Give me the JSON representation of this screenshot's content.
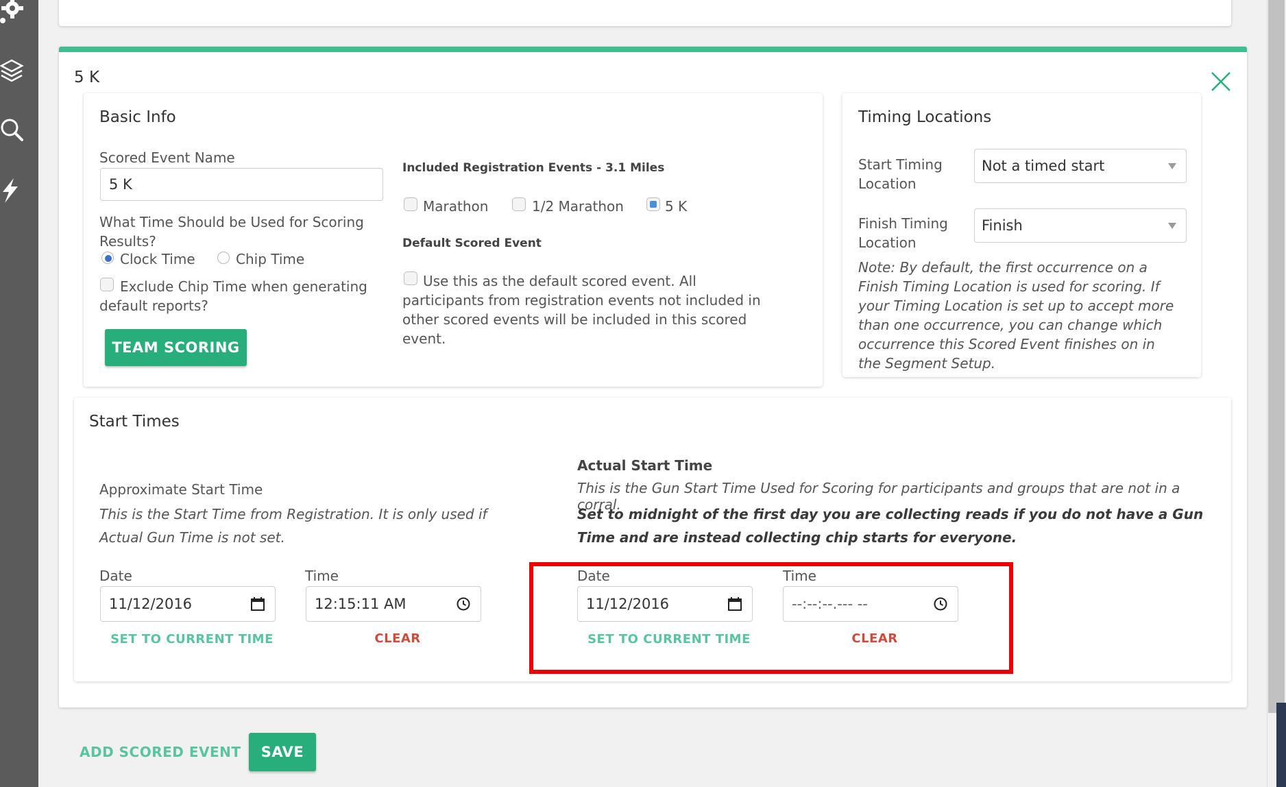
{
  "event": {
    "name": "5 K",
    "basic_info": {
      "heading": "Basic Info",
      "scored_event_name_label": "Scored Event Name",
      "scored_event_name_value": "5 K",
      "scoring_time_question": "What Time Should be Used for Scoring Results?",
      "clock_time_label": "Clock Time",
      "chip_time_label": "Chip Time",
      "selected_time": "Clock Time",
      "exclude_chip_label": "Exclude Chip Time when generating default reports?",
      "exclude_chip_checked": false,
      "team_scoring_button": "TEAM SCORING",
      "included_events_heading": "Included Registration Events - 3.1 Miles",
      "included_events": [
        {
          "label": "Marathon",
          "checked": false
        },
        {
          "label": "1/2 Marathon",
          "checked": false
        },
        {
          "label": "5 K",
          "checked": true
        }
      ],
      "default_scored_heading": "Default Scored Event",
      "default_scored_text": "Use this as the default scored event. All participants from registration events not included in other scored events will be included in this scored event.",
      "default_scored_checked": false
    },
    "timing_locations": {
      "heading": "Timing Locations",
      "start_label": "Start Timing Location",
      "start_value": "Not a timed start",
      "finish_label": "Finish Timing Location",
      "finish_value": "Finish",
      "note": "Note: By default, the first occurrence on a Finish Timing Location is used for scoring. If your Timing Location is set up to accept more than one occurrence, you can change which occurrence this Scored Event finishes on in the Segment Setup."
    },
    "start_times": {
      "heading": "Start Times",
      "approx": {
        "title": "Approximate Start Time",
        "description": "This is the Start Time from Registration. It is only used if Actual Gun Time is not set.",
        "date_label": "Date",
        "date_value": "11/12/2016",
        "time_label": "Time",
        "time_value": "12:15:11 AM",
        "set_current": "SET TO CURRENT TIME",
        "clear": "CLEAR"
      },
      "actual": {
        "title": "Actual Start Time",
        "description": "This is the Gun Start Time Used for Scoring for participants and groups that are not in a corral.",
        "bold_note": "Set to midnight of the first day you are collecting reads if you do not have a Gun Time and are instead collecting chip starts for everyone.",
        "date_label": "Date",
        "date_value": "11/12/2016",
        "time_label": "Time",
        "time_placeholder": "--:--:--.--- --",
        "set_current": "SET TO CURRENT TIME",
        "clear": "CLEAR"
      }
    }
  },
  "footer": {
    "add_scored_event": "ADD SCORED EVENT",
    "save": "SAVE"
  },
  "colors": {
    "accent_green": "#27ae7a",
    "link_green": "#58c4a0",
    "clear_red": "#cf4b3d",
    "highlight_red": "#ee0000",
    "sidebar": "#5b5b5b"
  },
  "icons": [
    "gear-icon",
    "layers-icon",
    "search-icon",
    "bolt-icon",
    "close-icon",
    "calendar-icon",
    "clock-icon"
  ]
}
